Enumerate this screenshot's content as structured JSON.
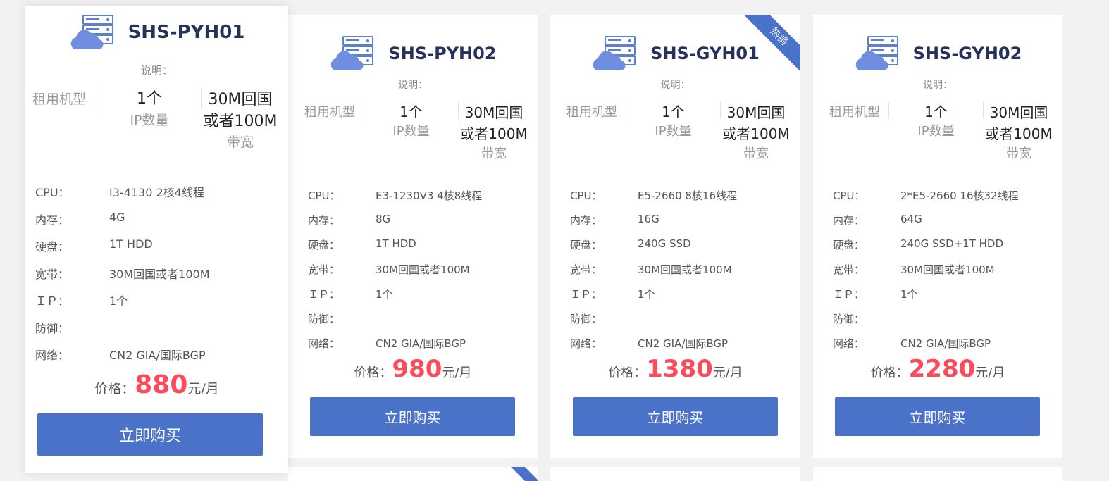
{
  "colors": {
    "accent": "#4a72c9",
    "price": "#ff4a5a",
    "title": "#26325a",
    "background": "#f2f2f2"
  },
  "icon": "server-cloud-icon",
  "spec_labels": {
    "cpu": "CPU：",
    "memory": "内存：",
    "disk": "硬盘：",
    "bandwidth": "宽带：",
    "ip": "ＩＰ：",
    "defense": "防御：",
    "network": "网络："
  },
  "products": [
    {
      "title": "SHS-PYH01",
      "desc_label": "说明：",
      "type_label": "租用机型",
      "ip_count": "1个",
      "ip_label": "IP数量",
      "bw_line1": "30M回国",
      "bw_line2": "或者100M",
      "bw_label": "带宽",
      "specs": {
        "cpu": "I3-4130 2核4线程",
        "memory": "4G",
        "disk": "1T HDD",
        "bandwidth": "30M回国或者100M",
        "ip": "1个",
        "defense": "",
        "network": "CN2 GIA/国际BGP"
      },
      "price_label": "价格：",
      "price": "880",
      "price_unit": "元/月",
      "buy_label": "立即购买",
      "ribbon": ""
    },
    {
      "title": "SHS-PYH02",
      "desc_label": "说明：",
      "type_label": "租用机型",
      "ip_count": "1个",
      "ip_label": "IP数量",
      "bw_line1": "30M回国",
      "bw_line2": "或者100M",
      "bw_label": "带宽",
      "specs": {
        "cpu": "E3-1230V3 4核8线程",
        "memory": "8G",
        "disk": "1T HDD",
        "bandwidth": "30M回国或者100M",
        "ip": "1个",
        "defense": "",
        "network": "CN2 GIA/国际BGP"
      },
      "price_label": "价格：",
      "price": "980",
      "price_unit": "元/月",
      "buy_label": "立即购买",
      "ribbon": ""
    },
    {
      "title": "SHS-GYH01",
      "desc_label": "说明：",
      "type_label": "租用机型",
      "ip_count": "1个",
      "ip_label": "IP数量",
      "bw_line1": "30M回国",
      "bw_line2": "或者100M",
      "bw_label": "带宽",
      "specs": {
        "cpu": "E5-2660 8核16线程",
        "memory": "16G",
        "disk": "240G SSD",
        "bandwidth": "30M回国或者100M",
        "ip": "1个",
        "defense": "",
        "network": "CN2 GIA/国际BGP"
      },
      "price_label": "价格：",
      "price": "1380",
      "price_unit": "元/月",
      "buy_label": "立即购买",
      "ribbon": "热销"
    },
    {
      "title": "SHS-GYH02",
      "desc_label": "说明：",
      "type_label": "租用机型",
      "ip_count": "1个",
      "ip_label": "IP数量",
      "bw_line1": "30M回国",
      "bw_line2": "或者100M",
      "bw_label": "带宽",
      "specs": {
        "cpu": "2*E5-2660 16核32线程",
        "memory": "64G",
        "disk": "240G SSD+1T HDD",
        "bandwidth": "30M回国或者100M",
        "ip": "1个",
        "defense": "",
        "network": "CN2 GIA/国际BGP"
      },
      "price_label": "价格：",
      "price": "2280",
      "price_unit": "元/月",
      "buy_label": "立即购买",
      "ribbon": ""
    }
  ]
}
